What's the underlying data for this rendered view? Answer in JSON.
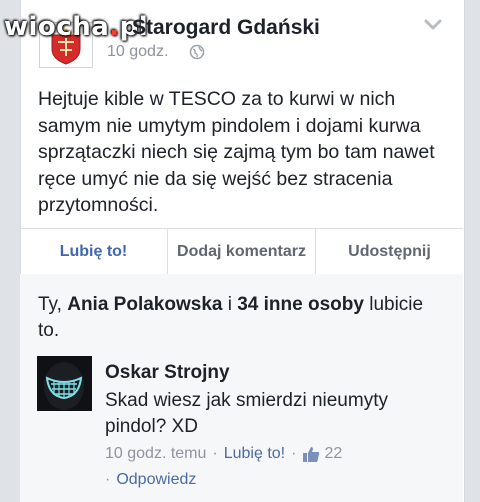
{
  "watermark": {
    "text_main": "wiocha",
    "text_dot": ".",
    "text_tld": "pl"
  },
  "post": {
    "page_name": "Mojdom Starogard Gdański",
    "page_name_visible": "Starogard Gdański",
    "time": "10 godz.",
    "icons": {
      "privacy": "globe-icon",
      "menu": "chevron-down-icon"
    },
    "text": "Hejtuje kible w TESCO za to kurwi w nich samym nie umytym pindolem i dojami kurwa sprzątaczki niech się zajmą tym bo tam nawet ręce umyć nie da się wejść bez stracenia przytomności."
  },
  "actions": {
    "like": "Lubię to!",
    "comment": "Dodaj komentarz",
    "share": "Udostępnij",
    "like_color": "#4267b2"
  },
  "likes_summary": {
    "prefix": "Ty, ",
    "person": "Ania Polakowska",
    "middle": " i ",
    "others": "34 inne osoby",
    "suffix": " lubicie to."
  },
  "comment": {
    "author": "Oskar Strojny",
    "text": "Skad wiesz jak smierdzi nieumyty pindol? XD",
    "time": "10 godz. temu",
    "like_label": "Lubię to!",
    "like_count": "22",
    "reply_label": "Odpowiedz",
    "separator": "·"
  }
}
